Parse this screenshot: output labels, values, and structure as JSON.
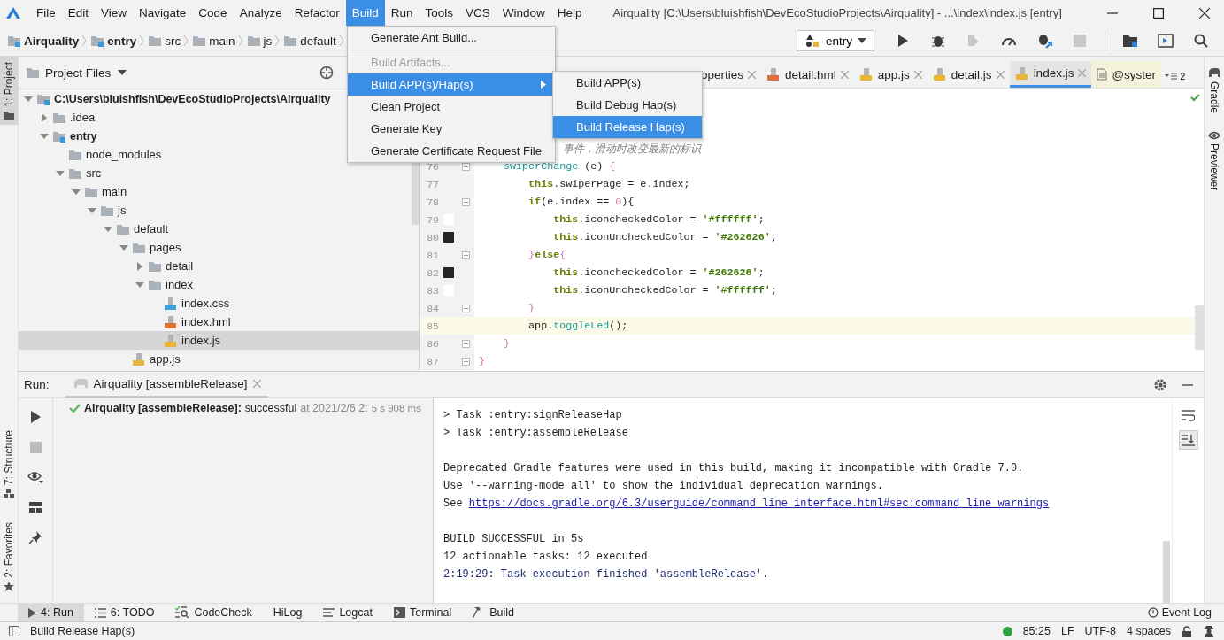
{
  "menu_bar": {
    "items": [
      {
        "label": "File",
        "selected": false
      },
      {
        "label": "Edit",
        "selected": false
      },
      {
        "label": "View",
        "selected": false
      },
      {
        "label": "Navigate",
        "selected": false
      },
      {
        "label": "Code",
        "selected": false
      },
      {
        "label": "Analyze",
        "selected": false
      },
      {
        "label": "Refactor",
        "selected": false
      },
      {
        "label": "Build",
        "selected": true
      },
      {
        "label": "Run",
        "selected": false
      },
      {
        "label": "Tools",
        "selected": false
      },
      {
        "label": "VCS",
        "selected": false
      },
      {
        "label": "Window",
        "selected": false
      },
      {
        "label": "Help",
        "selected": false
      }
    ],
    "title": "Airquality [C:\\Users\\bluishfish\\DevEcoStudioProjects\\Airquality] - ...\\index\\index.js [entry]"
  },
  "breadcrumb": [
    {
      "label": "Airquality",
      "kind": "module"
    },
    {
      "label": "entry",
      "kind": "module"
    },
    {
      "label": "src",
      "kind": "folder"
    },
    {
      "label": "main",
      "kind": "folder"
    },
    {
      "label": "js",
      "kind": "folder"
    },
    {
      "label": "default",
      "kind": "folder"
    }
  ],
  "toolbar": {
    "run_config": "entry",
    "buttons": [
      {
        "kind": "run",
        "disabled": false
      },
      {
        "kind": "debug",
        "disabled": false
      },
      {
        "kind": "attach",
        "disabled": true
      },
      {
        "kind": "profile",
        "disabled": false
      },
      {
        "kind": "debug-attach",
        "disabled": false
      },
      {
        "kind": "stop",
        "disabled": true
      },
      {
        "kind": "structure",
        "disabled": false
      },
      {
        "kind": "device",
        "disabled": false
      },
      {
        "kind": "search",
        "disabled": false
      }
    ]
  },
  "build_menu": {
    "items": [
      {
        "kind": "item",
        "label": "Generate Ant Build...",
        "disabled": false,
        "selected": false
      },
      {
        "kind": "separator"
      },
      {
        "kind": "item",
        "label": "Build Artifacts...",
        "disabled": true,
        "selected": false
      },
      {
        "kind": "submenu",
        "label": "Build APP(s)/Hap(s)",
        "disabled": false,
        "selected": true
      },
      {
        "kind": "item",
        "label": "Clean Project",
        "disabled": false,
        "selected": false
      },
      {
        "kind": "item",
        "label": "Generate Key",
        "disabled": false,
        "selected": false
      },
      {
        "kind": "item",
        "label": "Generate Certificate Request File",
        "disabled": false,
        "selected": false
      }
    ]
  },
  "submenu": {
    "items": [
      {
        "label": "Build APP(s)",
        "selected": false
      },
      {
        "label": "Build Debug Hap(s)",
        "selected": false
      },
      {
        "label": "Build Release Hap(s)",
        "selected": true
      }
    ]
  },
  "left_strip": {
    "top_tabs": [
      {
        "label": "1: Project",
        "selected": true
      }
    ],
    "bottom_tabs": [
      {
        "label": "7: Structure",
        "selected": false,
        "kind": "structure"
      },
      {
        "label": "2: Favorites",
        "selected": false,
        "kind": "favorites"
      }
    ]
  },
  "project_panel": {
    "title": "Project Files",
    "tree": [
      {
        "label": "C:\\Users\\bluishfish\\DevEcoStudioProjects\\Airquality",
        "kind": "module",
        "expanded": true,
        "selected": false,
        "children": [
          {
            "label": ".idea",
            "kind": "folder",
            "expanded": false,
            "selected": false
          },
          {
            "label": "entry",
            "kind": "module",
            "expanded": true,
            "selected": false,
            "children": [
              {
                "label": "node_modules",
                "kind": "folder",
                "selected": false
              },
              {
                "label": "src",
                "kind": "folder",
                "expanded": true,
                "selected": false,
                "children": [
                  {
                    "label": "main",
                    "kind": "folder",
                    "expanded": true,
                    "selected": false,
                    "children": [
                      {
                        "label": "js",
                        "kind": "folder",
                        "expanded": true,
                        "selected": false,
                        "children": [
                          {
                            "label": "default",
                            "kind": "folder",
                            "expanded": true,
                            "selected": false,
                            "children": [
                              {
                                "label": "pages",
                                "kind": "folder",
                                "expanded": true,
                                "selected": false,
                                "children": [
                                  {
                                    "label": "detail",
                                    "kind": "folder",
                                    "expanded": false,
                                    "selected": false
                                  },
                                  {
                                    "label": "index",
                                    "kind": "folder",
                                    "expanded": true,
                                    "selected": false,
                                    "children": [
                                      {
                                        "label": "index.css",
                                        "kind": "css",
                                        "selected": false
                                      },
                                      {
                                        "label": "index.hml",
                                        "kind": "hml",
                                        "selected": false
                                      },
                                      {
                                        "label": "index.js",
                                        "kind": "js",
                                        "selected": true
                                      }
                                    ]
                                  }
                                ]
                              },
                              {
                                "label": "app.js",
                                "kind": "js",
                                "selected": false
                              }
                            ]
                          }
                        ]
                      }
                    ]
                  }
                ]
              }
            ]
          }
        ]
      }
    ]
  },
  "editor": {
    "tabs": [
      {
        "label": "operties",
        "kind": "file",
        "selected": false
      },
      {
        "label": "detail.hml",
        "kind": "hml",
        "selected": false
      },
      {
        "label": "app.js",
        "kind": "js",
        "selected": false
      },
      {
        "label": "detail.js",
        "kind": "js",
        "selected": false
      },
      {
        "label": "index.js",
        "kind": "js",
        "selected": true
      },
      {
        "label": "@syster",
        "kind": "doc",
        "selected": false
      }
    ],
    "overflow": "2",
    "lines": [
      {
        "kind": "clipped",
        "current": false,
        "segments": [
          {
            "text": "事件，滑动时改变最新的标识",
            "kind": "comment"
          }
        ]
      },
      {
        "number": "76",
        "kind": "code",
        "current": false,
        "fold": true,
        "segments": [
          {
            "text": "    swiperChange",
            "kind": "fn"
          },
          {
            "text": " (e) ",
            "kind": "plain"
          },
          {
            "text": "{",
            "kind": "brace"
          }
        ]
      },
      {
        "number": "77",
        "kind": "code",
        "current": false,
        "fold": false,
        "segments": [
          {
            "text": "        this",
            "kind": "kw"
          },
          {
            "text": ".swiperPage = e.index;",
            "kind": "plain"
          }
        ]
      },
      {
        "number": "78",
        "kind": "code",
        "current": false,
        "fold": true,
        "segments": [
          {
            "text": "        if",
            "kind": "kw"
          },
          {
            "text": "(e.index == ",
            "kind": "plain"
          },
          {
            "text": "0",
            "kind": "num"
          },
          {
            "text": "){",
            "kind": "plain"
          }
        ]
      },
      {
        "number": "79",
        "kind": "code",
        "current": false,
        "fold": false,
        "color": "#ffffff",
        "segments": [
          {
            "text": "            this",
            "kind": "kw"
          },
          {
            "text": ".iconcheckedColor = ",
            "kind": "plain"
          },
          {
            "text": "'#ffffff'",
            "kind": "str"
          },
          {
            "text": ";",
            "kind": "plain"
          }
        ]
      },
      {
        "number": "80",
        "kind": "code",
        "current": false,
        "fold": false,
        "color": "#262626",
        "segments": [
          {
            "text": "            this",
            "kind": "kw"
          },
          {
            "text": ".iconUncheckedColor = ",
            "kind": "plain"
          },
          {
            "text": "'#262626'",
            "kind": "str"
          },
          {
            "text": ";",
            "kind": "plain"
          }
        ]
      },
      {
        "number": "81",
        "kind": "code",
        "current": false,
        "fold": true,
        "segments": [
          {
            "text": "        }",
            "kind": "brace"
          },
          {
            "text": "else",
            "kind": "kw"
          },
          {
            "text": "{",
            "kind": "brace"
          }
        ]
      },
      {
        "number": "82",
        "kind": "code",
        "current": false,
        "fold": false,
        "color": "#262626",
        "segments": [
          {
            "text": "            this",
            "kind": "kw"
          },
          {
            "text": ".iconcheckedColor = ",
            "kind": "plain"
          },
          {
            "text": "'#262626'",
            "kind": "str"
          },
          {
            "text": ";",
            "kind": "plain"
          }
        ]
      },
      {
        "number": "83",
        "kind": "code",
        "current": false,
        "fold": false,
        "color": "#ffffff",
        "segments": [
          {
            "text": "            this",
            "kind": "kw"
          },
          {
            "text": ".iconUncheckedColor = ",
            "kind": "plain"
          },
          {
            "text": "'#ffffff'",
            "kind": "str"
          },
          {
            "text": ";",
            "kind": "plain"
          }
        ]
      },
      {
        "number": "84",
        "kind": "code",
        "current": false,
        "fold": true,
        "segments": [
          {
            "text": "        }",
            "kind": "brace"
          }
        ]
      },
      {
        "number": "85",
        "kind": "code",
        "current": true,
        "fold": false,
        "segments": [
          {
            "text": "        app.",
            "kind": "plain"
          },
          {
            "text": "toggleLed",
            "kind": "fn"
          },
          {
            "text": "();",
            "kind": "plain"
          }
        ]
      },
      {
        "number": "86",
        "kind": "code",
        "current": false,
        "fold": true,
        "segments": [
          {
            "text": "    }",
            "kind": "brace"
          }
        ]
      },
      {
        "number": "87",
        "kind": "code",
        "current": false,
        "fold": true,
        "segments": [
          {
            "text": "}",
            "kind": "brace"
          }
        ]
      }
    ]
  },
  "right_strip": {
    "tabs": [
      {
        "label": "Gradle",
        "kind": "gradle"
      },
      {
        "label": "Previewer",
        "kind": "previewer"
      }
    ]
  },
  "run_panel": {
    "label": "Run:",
    "tabs": [
      {
        "label": "Airquality [assembleRelease]",
        "selected": true
      }
    ],
    "tools": [
      {
        "kind": "rerun",
        "disabled": false
      },
      {
        "kind": "stop",
        "disabled": true
      },
      {
        "kind": "eye",
        "disabled": false
      },
      {
        "kind": "layout",
        "disabled": false
      },
      {
        "kind": "pin",
        "disabled": false
      }
    ],
    "result": {
      "name": "Airquality [assembleRelease]:",
      "status": "successful",
      "time": "at 2021/2/6 2:",
      "duration": "5 s 908 ms"
    },
    "console": [
      {
        "kind": "text",
        "text": "> Task :entry:signReleaseHap"
      },
      {
        "kind": "text",
        "text": "> Task :entry:assembleRelease"
      },
      {
        "kind": "blank"
      },
      {
        "kind": "text",
        "text": "Deprecated Gradle features were used in this build, making it incompatible with Gradle 7.0."
      },
      {
        "kind": "text",
        "text": "Use '--warning-mode all' to show the individual deprecation warnings."
      },
      {
        "kind": "link",
        "text": "See ",
        "link": "https://docs.gradle.org/6.3/userguide/command_line_interface.html#sec:command_line_warnings"
      },
      {
        "kind": "blank"
      },
      {
        "kind": "text",
        "text": "BUILD SUCCESSFUL in 5s"
      },
      {
        "kind": "text",
        "text": "12 actionable tasks: 12 executed"
      },
      {
        "kind": "info",
        "text": "2:19:29: Task execution finished 'assembleRelease'."
      }
    ],
    "console_tools": [
      {
        "kind": "wrap",
        "on": false
      },
      {
        "kind": "scroll-end",
        "on": true
      }
    ]
  },
  "bottom_tabs": [
    {
      "label": "4: Run",
      "kind": "run",
      "selected": true
    },
    {
      "label": "6: TODO",
      "kind": "todo",
      "selected": false
    },
    {
      "label": "CodeCheck",
      "kind": "codecheck",
      "selected": false
    },
    {
      "label": "HiLog",
      "kind": "none",
      "selected": false
    },
    {
      "label": "Logcat",
      "kind": "logcat",
      "selected": false
    },
    {
      "label": "Terminal",
      "kind": "terminal",
      "selected": false
    },
    {
      "label": "Build",
      "kind": "build",
      "selected": false
    }
  ],
  "event_log": "Event Log",
  "status_bar": {
    "message": "Build Release Hap(s)",
    "position": "85:25",
    "line_separator": "LF",
    "encoding": "UTF-8",
    "indent": "4 spaces"
  }
}
